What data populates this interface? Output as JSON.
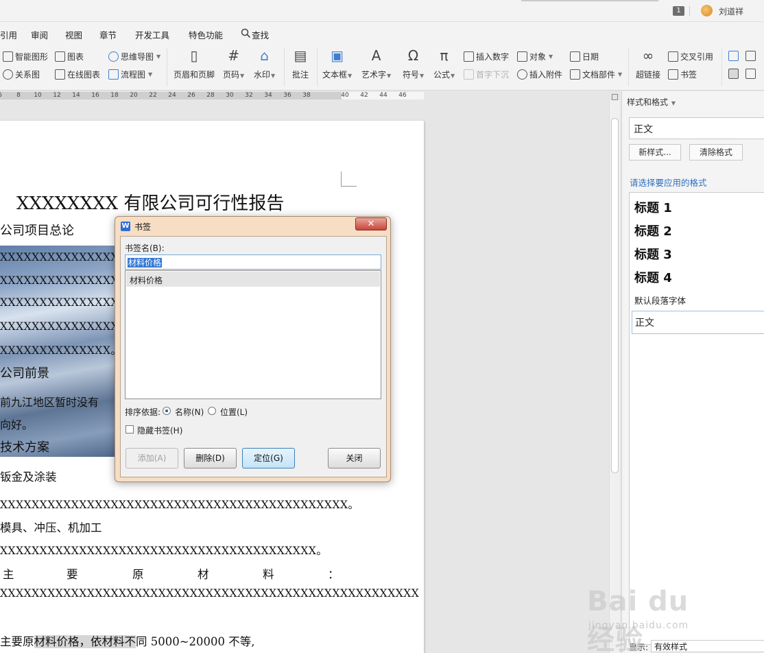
{
  "titlebar": {
    "badge": "1",
    "user": "刘道祥"
  },
  "menu": [
    "引用",
    "审阅",
    "视图",
    "章节",
    "开发工具",
    "特色功能",
    "查找"
  ],
  "ribbon": {
    "smart_shape": "智能图形",
    "chart": "图表",
    "mind_map": "思维导图",
    "relation_map": "关系图",
    "online_chart": "在线图表",
    "flowchart": "流程图",
    "header_footer": "页眉和页脚",
    "page_number": "页码",
    "watermark": "水印",
    "comment": "批注",
    "textbox": "文本框",
    "wordart": "艺术字",
    "symbol": "符号",
    "formula": "公式",
    "insert_number": "插入数字",
    "object": "对象",
    "date": "日期",
    "drop_cap": "首字下沉",
    "attachment": "插入附件",
    "doc_parts": "文档部件",
    "hyperlink": "超链接",
    "cross_ref": "交叉引用",
    "bookmark": "书签"
  },
  "ruler": [
    "6",
    "8",
    "10",
    "12",
    "14",
    "16",
    "18",
    "20",
    "22",
    "24",
    "26",
    "28",
    "30",
    "32",
    "34",
    "36",
    "38",
    "40",
    "42",
    "44",
    "46"
  ],
  "document": {
    "title": "XXXXXXXX 有限公司可行性报告",
    "h1": "公司项目总论",
    "x_line": "XXXXXXXXXXXXXXXXXXXXXXXXXXXXXXXXXXXXXXXXXXXXX",
    "x_end": "XXXXXXXXXXXXXX。",
    "h2": "公司前景",
    "p_front": "前九江地区暂时没有",
    "p_front2": "向好。",
    "h3": "技术方案",
    "s1": "钣金及涂装",
    "line_a": "XXXXXXXXXXXXXXXXXXXXXXXXXXXXXXXXXXXXXXXXXXXX。",
    "s2": "模具、冲压、机加工",
    "line_b": "XXXXXXXXXXXXXXXXXXXXXXXXXXXXXXXXXXXXXXXX。",
    "s3": [
      "主",
      "要",
      "原",
      "材",
      "料",
      "："
    ],
    "line_c": "XXXXXXXXXXXXXXXXXXXXXXXXXXXXXXXXXXXXXXXXXXXXXXXXXXXXX",
    "last_pre": "主要原",
    "last_hl": "材料价格，依材料不",
    "last_post": "同 5000~20000 不等,"
  },
  "pane": {
    "title": "样式和格式",
    "current": "正文",
    "new_style": "新样式...",
    "clear_format": "清除格式",
    "apply_label": "请选择要应用的格式",
    "styles": [
      "标题  1",
      "标题  2",
      "标题  3",
      "标题  4"
    ],
    "default_font": "默认段落字体",
    "body": "正文",
    "show_label": "显示:",
    "show_value": "有效样式"
  },
  "dialog": {
    "title": "书签",
    "name_label": "书签名(B):",
    "name_value": "材料价格",
    "list_item": "材料价格",
    "sort_label": "排序依据:",
    "sort_name": "名称(N)",
    "sort_position": "位置(L)",
    "hidden": "隐藏书签(H)",
    "add": "添加(A)",
    "delete": "删除(D)",
    "goto": "定位(G)",
    "close": "关闭"
  },
  "watermark": {
    "text": "Bai du 经验",
    "sub": "jingyan.baidu.com"
  }
}
